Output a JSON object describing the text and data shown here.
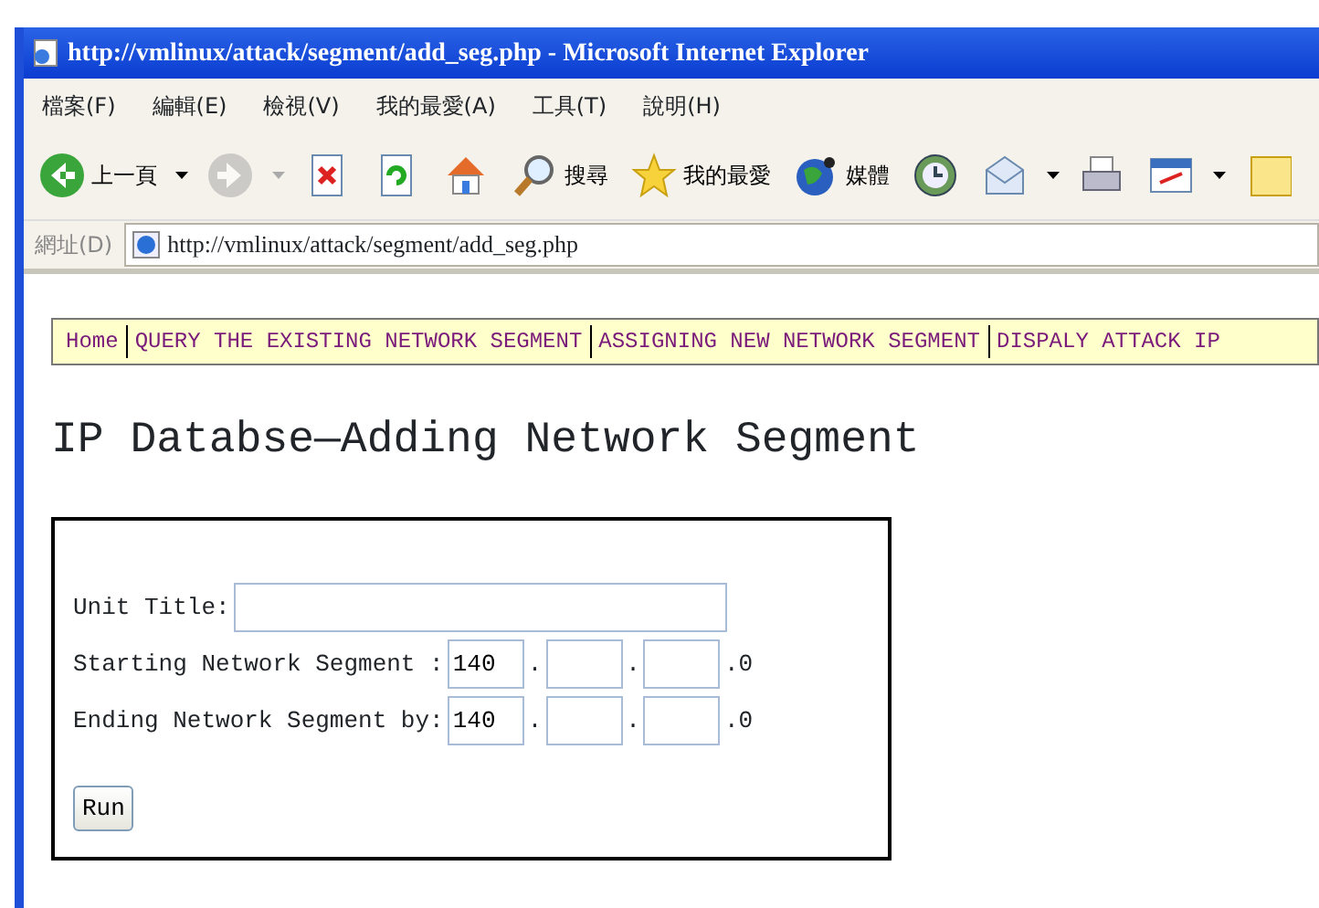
{
  "window": {
    "title": "http://vmlinux/attack/segment/add_seg.php - Microsoft Internet Explorer"
  },
  "menu": [
    "檔案(F)",
    "編輯(E)",
    "檢視(V)",
    "我的最愛(A)",
    "工具(T)",
    "說明(H)"
  ],
  "toolbar": [
    {
      "kind": "back",
      "label": "上一頁",
      "caret": true,
      "disabled": false
    },
    {
      "kind": "forward",
      "caret": true,
      "disabled": true
    },
    {
      "kind": "stop",
      "caret": false,
      "disabled": false
    },
    {
      "kind": "refresh",
      "caret": false,
      "disabled": false
    },
    {
      "kind": "home",
      "caret": false,
      "disabled": false
    },
    {
      "kind": "search",
      "label": "搜尋",
      "caret": false,
      "disabled": false
    },
    {
      "kind": "favorites",
      "label": "我的最愛",
      "caret": false,
      "disabled": false
    },
    {
      "kind": "media",
      "label": "媒體",
      "caret": false,
      "disabled": false
    },
    {
      "kind": "history",
      "caret": false,
      "disabled": false
    },
    {
      "kind": "mail",
      "caret": true,
      "disabled": false
    },
    {
      "kind": "print",
      "caret": false,
      "disabled": false
    },
    {
      "kind": "edit",
      "caret": true,
      "disabled": false
    },
    {
      "kind": "folder",
      "caret": false,
      "disabled": false
    }
  ],
  "address": {
    "label": "網址(D)",
    "url": "http://vmlinux/attack/segment/add_seg.php"
  },
  "nav": [
    "Home",
    "QUERY THE EXISTING NETWORK SEGMENT",
    "ASSIGNING NEW NETWORK SEGMENT",
    "DISPALY ATTACK IP"
  ],
  "heading": "IP Databse—Adding Network Segment",
  "form": {
    "rows": [
      {
        "label": "Unit Title:",
        "parts": [
          {
            "kind": "wide"
          }
        ]
      },
      {
        "label": "Starting Network Segment :",
        "parts": [
          {
            "kind": "octet",
            "value": "140"
          },
          {
            "kind": "text",
            "text": "."
          },
          {
            "kind": "octet"
          },
          {
            "kind": "text",
            "text": "."
          },
          {
            "kind": "octet"
          },
          {
            "kind": "text",
            "text": ".0"
          }
        ]
      },
      {
        "label": "Ending Network Segment by:",
        "parts": [
          {
            "kind": "octet",
            "value": "140"
          },
          {
            "kind": "text",
            "text": "."
          },
          {
            "kind": "octet"
          },
          {
            "kind": "text",
            "text": "."
          },
          {
            "kind": "octet"
          },
          {
            "kind": "text",
            "text": ".0"
          }
        ]
      }
    ],
    "button": "Run"
  }
}
